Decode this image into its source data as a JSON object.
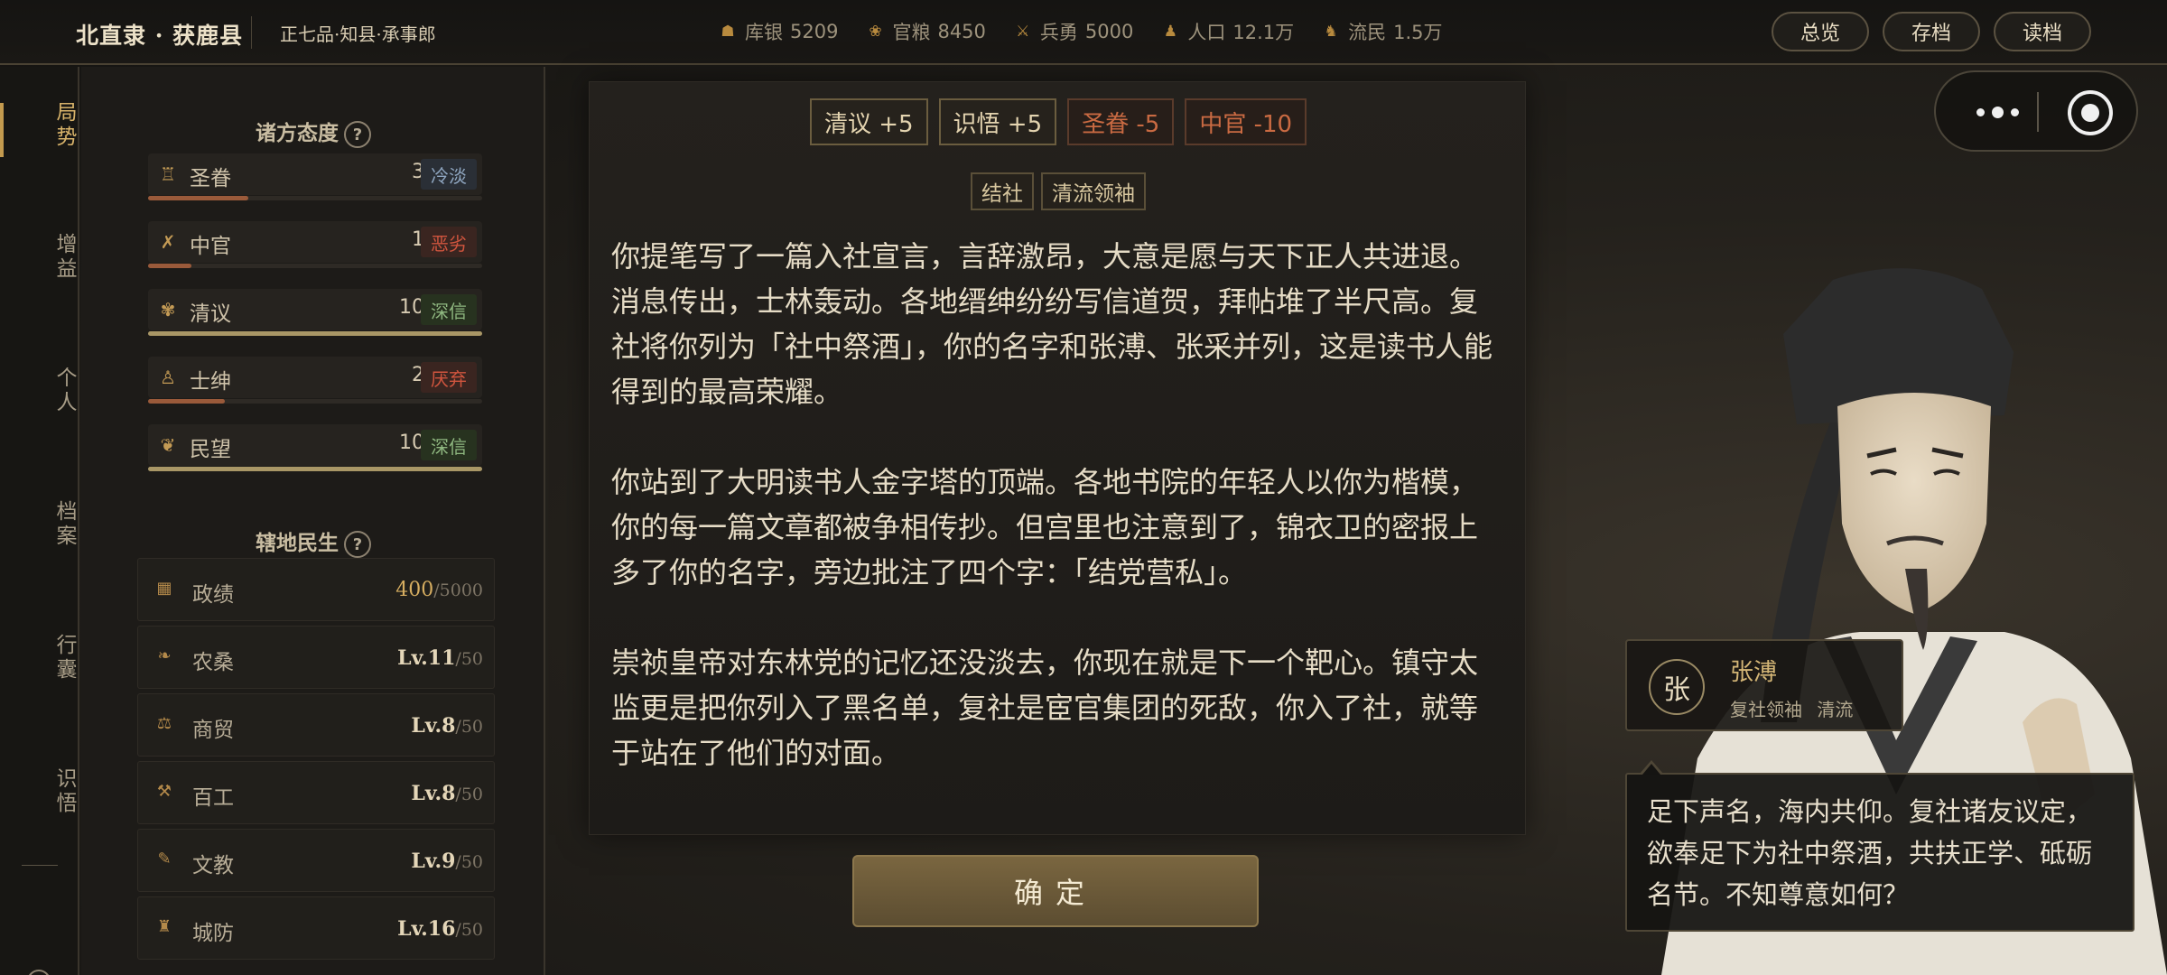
{
  "header": {
    "county": "北直隶 · 获鹿县",
    "rank": "正七品·知县·承事郎",
    "resources": [
      {
        "icon": "silver-icon",
        "glyph": "☗",
        "label": "库银",
        "value": "5209"
      },
      {
        "icon": "grain-icon",
        "glyph": "❀",
        "label": "官粮",
        "value": "8450"
      },
      {
        "icon": "soldier-icon",
        "glyph": "⚔",
        "label": "兵勇",
        "value": "5000"
      },
      {
        "icon": "population-icon",
        "glyph": "♟",
        "label": "人口",
        "value": "12.1万"
      },
      {
        "icon": "refugee-icon",
        "glyph": "♞",
        "label": "流民",
        "value": "1.5万"
      }
    ],
    "buttons": {
      "overview": "总览",
      "save": "存档",
      "load": "读档"
    }
  },
  "nav": {
    "items": [
      "局势",
      "增益",
      "个人",
      "档案",
      "行囊",
      "识悟"
    ]
  },
  "factions": {
    "title": "诸方态度",
    "help": "?",
    "items": [
      {
        "icon": "emperor-icon",
        "glyph": "♖",
        "name": "圣眷",
        "value": "30",
        "tag": "冷淡",
        "fill": 0.3,
        "bar": "#9a5a3a",
        "tagColor": "#8fa6c0",
        "tagBg": "#2a2f36"
      },
      {
        "icon": "eunuch-icon",
        "glyph": "✗",
        "name": "中官",
        "value": "13",
        "tag": "恶劣",
        "fill": 0.13,
        "bar": "#9a5a3a",
        "tagColor": "#d0553e",
        "tagBg": "#3a2520"
      },
      {
        "icon": "scholar-icon",
        "glyph": "✾",
        "name": "清议",
        "value": "100",
        "tag": "深信",
        "fill": 1.0,
        "bar": "#a99766",
        "tagColor": "#8fb880",
        "tagBg": "#27321f"
      },
      {
        "icon": "gentry-icon",
        "glyph": "♙",
        "name": "士绅",
        "value": "23",
        "tag": "厌弃",
        "fill": 0.23,
        "bar": "#9a5a3a",
        "tagColor": "#d0553e",
        "tagBg": "#3a2520"
      },
      {
        "icon": "people-icon",
        "glyph": "❦",
        "name": "民望",
        "value": "100",
        "tag": "深信",
        "fill": 1.0,
        "bar": "#a99766",
        "tagColor": "#8fb880",
        "tagBg": "#27321f"
      }
    ]
  },
  "livelihood": {
    "title": "辖地民生",
    "help": "?",
    "items": [
      {
        "icon": "merit-icon",
        "glyph": "▦",
        "name": "政绩",
        "value": "400",
        "max": "/5000",
        "gold": true
      },
      {
        "icon": "farming-icon",
        "glyph": "❧",
        "name": "农桑",
        "value": "Lv.11",
        "max": "/50"
      },
      {
        "icon": "trade-icon",
        "glyph": "⚖",
        "name": "商贸",
        "value": "Lv.8",
        "max": "/50"
      },
      {
        "icon": "craft-icon",
        "glyph": "⚒",
        "name": "百工",
        "value": "Lv.8",
        "max": "/50"
      },
      {
        "icon": "education-icon",
        "glyph": "✎",
        "name": "文教",
        "value": "Lv.9",
        "max": "/50"
      },
      {
        "icon": "defense-icon",
        "glyph": "♜",
        "name": "城防",
        "value": "Lv.16",
        "max": "/50"
      }
    ]
  },
  "event": {
    "effects": [
      {
        "label": "清议 +5",
        "kind": "pos"
      },
      {
        "label": "识悟 +5",
        "kind": "pos"
      },
      {
        "label": "圣眷 -5",
        "kind": "neg"
      },
      {
        "label": "中官 -10",
        "kind": "neg"
      }
    ],
    "tags": [
      "结社",
      "清流领袖"
    ],
    "paragraphs": [
      "你提笔写了一篇入社宣言，言辞激昂，大意是愿与天下正人共进退。消息传出，士林轰动。各地缙绅纷纷写信道贺，拜帖堆了半尺高。复社将你列为「社中祭酒」，你的名字和张溥、张采并列，这是读书人能得到的最高荣耀。",
      "你站到了大明读书人金字塔的顶端。各地书院的年轻人以你为楷模，你的每一篇文章都被争相传抄。但宫里也注意到了，锦衣卫的密报上多了你的名字，旁边批注了四个字：「结党营私」。",
      "崇祯皇帝对东林党的记忆还没淡去，你现在就是下一个靶心。镇守太监更是把你列入了黑名单，复社是宦官集团的死敌，你入了社，就等于站在了他们的对面。"
    ],
    "confirm": "确定"
  },
  "character": {
    "seal": "张",
    "name": "张溥",
    "roles": "复社领袖 清流",
    "speech": "足下声名，海内共仰。复社诸友议定，欲奉足下为社中祭酒，共扶正学、砥砺名节。不知尊意如何？"
  }
}
